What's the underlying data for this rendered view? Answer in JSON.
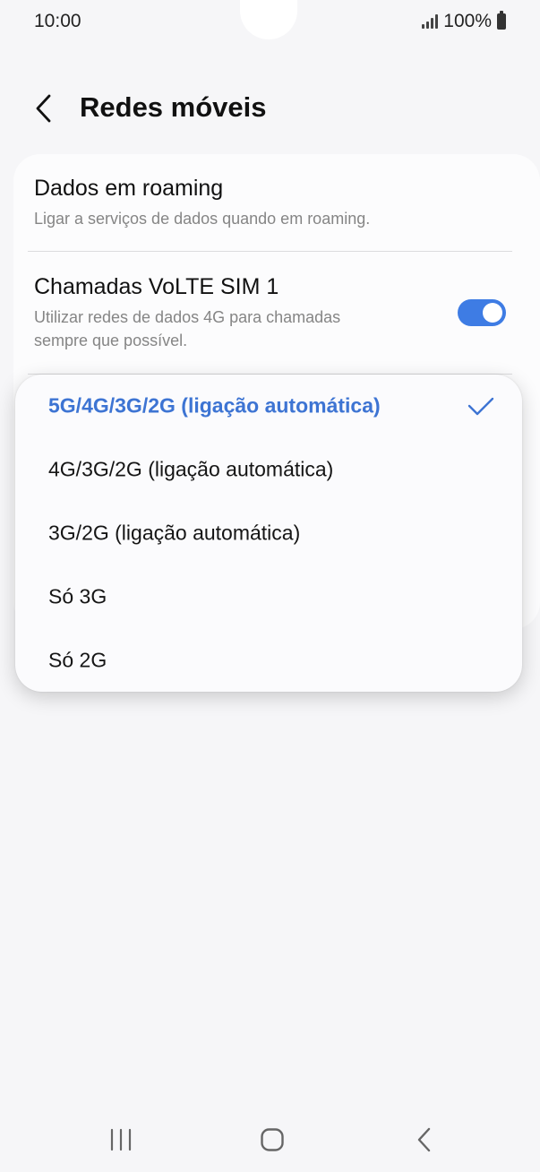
{
  "status_bar": {
    "time": "10:00",
    "battery": "100%",
    "icons": [
      "signal-icon",
      "battery-icon"
    ]
  },
  "header": {
    "title": "Redes móveis",
    "back_icon": "chevron-left-icon"
  },
  "settings": {
    "roaming": {
      "title": "Dados em roaming",
      "subtitle": "Ligar a serviços de dados quando em roaming."
    },
    "volte": {
      "title": "Chamadas VoLTE SIM 1",
      "subtitle_line1": "Utilizar redes de dados 4G para chamadas",
      "subtitle_line2": "sempre que possível.",
      "enabled": true
    }
  },
  "network_mode_menu": {
    "options": [
      {
        "label": "5G/4G/3G/2G (ligação automática)",
        "selected": true
      },
      {
        "label": "4G/3G/2G (ligação automática)",
        "selected": false
      },
      {
        "label": "3G/2G (ligação automática)",
        "selected": false
      },
      {
        "label": "Só 3G",
        "selected": false
      },
      {
        "label": "Só 2G",
        "selected": false
      }
    ],
    "check_icon": "checkmark-icon"
  },
  "nav_bar": {
    "icons": [
      "recent-apps-icon",
      "home-icon",
      "back-icon"
    ]
  },
  "colors": {
    "accent": "#3e7ce4",
    "selected_text": "#3d74d3",
    "background": "#f6f6f8",
    "card": "#fcfcfd"
  }
}
